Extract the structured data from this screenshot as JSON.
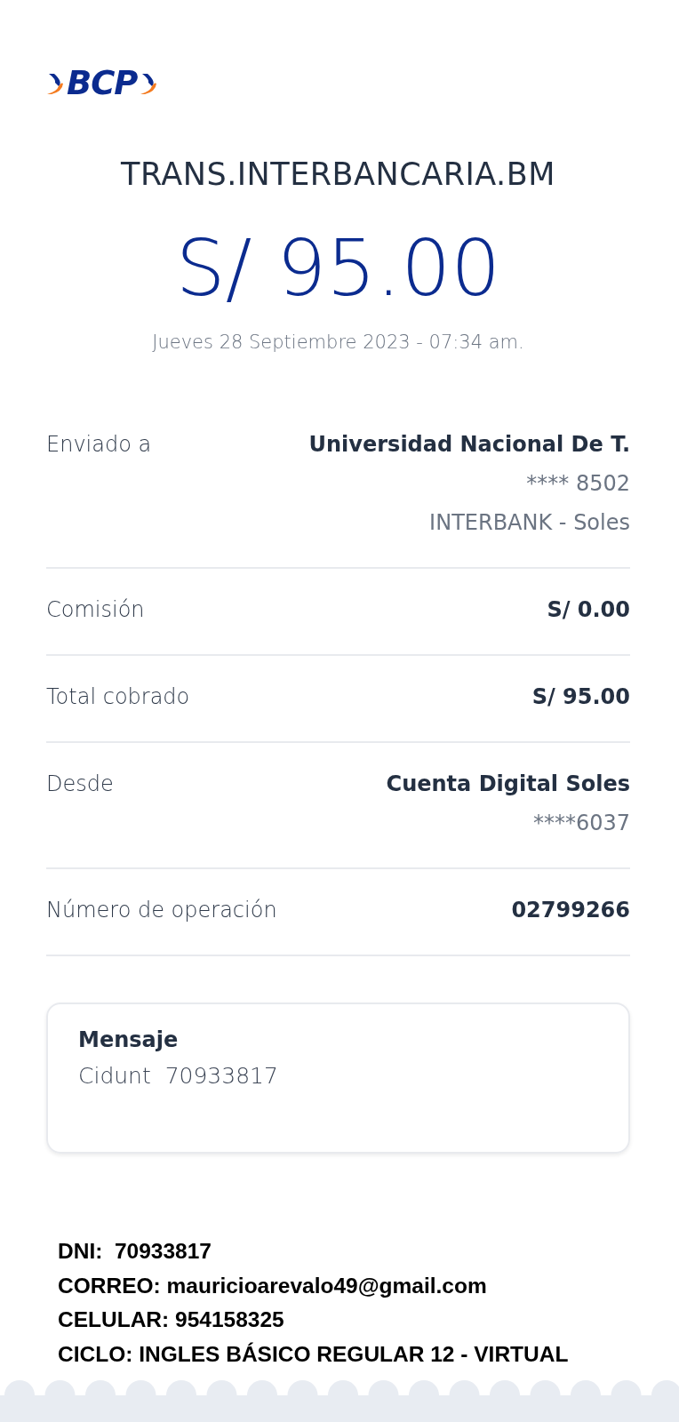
{
  "logo": {
    "text": "BCP"
  },
  "title": "TRANS.INTERBANCARIA.BM",
  "amount": "S/ 95.00",
  "date": "Jueves 28 Septiembre 2023 - 07:34 am.",
  "details": [
    {
      "label": "Enviado a",
      "lines": [
        {
          "text": "Universidad Nacional De T.",
          "kind": "strong"
        },
        {
          "text": "**** 8502",
          "kind": "muted"
        },
        {
          "text": "INTERBANK - Soles",
          "kind": "muted"
        }
      ]
    },
    {
      "label": "Comisión",
      "lines": [
        {
          "text": "S/ 0.00",
          "kind": "strong"
        }
      ]
    },
    {
      "label": "Total cobrado",
      "lines": [
        {
          "text": "S/ 95.00",
          "kind": "strong"
        }
      ]
    },
    {
      "label": "Desde",
      "lines": [
        {
          "text": "Cuenta Digital Soles",
          "kind": "strong"
        },
        {
          "text": "****6037",
          "kind": "muted"
        }
      ]
    },
    {
      "label": "Número de operación",
      "lines": [
        {
          "text": "02799266",
          "kind": "strong"
        }
      ]
    }
  ],
  "message": {
    "heading": "Mensaje",
    "body": "Cidunt  70933817"
  },
  "annotation": [
    "DNI:  70933817",
    "CORREO: mauricioarevalo49@gmail.com",
    "CELULAR: 954158325",
    "CICLO: INGLES BÁSICO REGULAR 12 - VIRTUAL"
  ]
}
